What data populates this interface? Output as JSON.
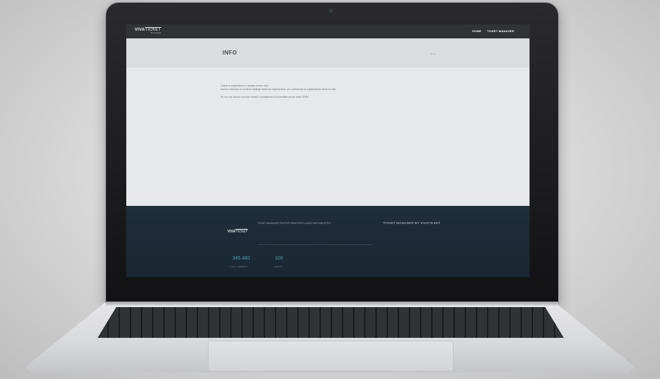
{
  "nav": {
    "logo_main": "VIVA",
    "logo_ticket": "TICKET",
    "logo_sub": "MANAGER",
    "links": [
      "HOME",
      "TICKET MANAGER"
    ]
  },
  "titlebar": {
    "title": "INFO",
    "breadcrumb": "Home"
  },
  "content": {
    "lines": [
      "Grazie la registrazione è andata a buon fine!",
      "A breve riceverai un email di riepilogo della tua registrazione, per confermare la registrazione clicca sul link.",
      "Se non hai ancora ricevuto l'email, ti consigliamo di controllare anche nello SPAM"
    ]
  },
  "footer": {
    "logo_main": "VIVA",
    "logo_ticket": "TICKET",
    "tagline": "TICKET MANAGER PIATTAFORMA PER LA MEETING INDUSTRY",
    "heading": "TICKET MANAGER BY VIVATICKET",
    "stats": [
      {
        "value": "345.480",
        "label": "TICKET GENERATI"
      },
      {
        "value": "100",
        "label": "EVENTI"
      }
    ]
  },
  "colors": {
    "navbar": "#303336",
    "footer": "#1f2e3b",
    "accent": "#3fa3b4"
  }
}
